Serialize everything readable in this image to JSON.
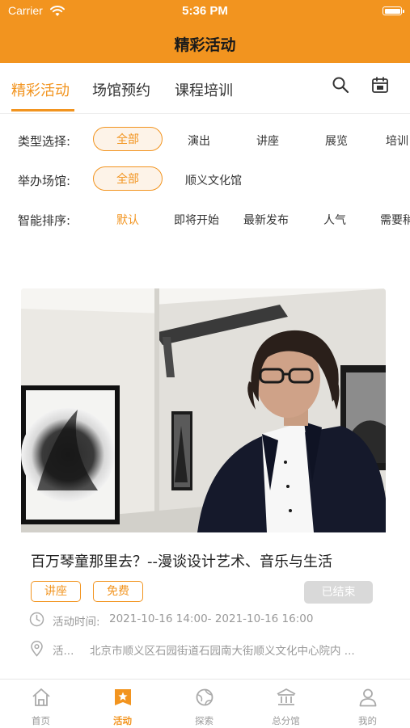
{
  "status_bar": {
    "carrier": "Carrier",
    "time": "5:36 PM"
  },
  "nav": {
    "title": "精彩活动"
  },
  "tabs": [
    {
      "label": "精彩活动"
    },
    {
      "label": "场馆预约"
    },
    {
      "label": "课程培训"
    }
  ],
  "icons": {
    "search": "search-icon",
    "calendar": "calendar-icon"
  },
  "filters": {
    "type": {
      "label": "类型选择:",
      "options": [
        "全部",
        "演出",
        "讲座",
        "展览",
        "培训"
      ]
    },
    "venue": {
      "label": "举办场馆:",
      "options": [
        "全部",
        "顺义文化馆"
      ]
    },
    "sort": {
      "label": "智能排序:",
      "options": [
        "默认",
        "即将开始",
        "最新发布",
        "人气",
        "需要稍"
      ]
    }
  },
  "event": {
    "title": "百万琴童那里去？--漫谈设计艺术、音乐与生活",
    "tags": [
      "讲座",
      "免费"
    ],
    "status": "已结束",
    "time_label": "活动时间:",
    "time_value": "2021-10-16 14:00- 2021-10-16 16:00",
    "place_label": "活...",
    "place_value": "北京市顺义区石园街道石园南大街顺义文化中心院内 ..."
  },
  "bottom_nav": [
    {
      "label": "首页",
      "icon": "home-icon"
    },
    {
      "label": "活动",
      "icon": "star-icon"
    },
    {
      "label": "探索",
      "icon": "explore-icon"
    },
    {
      "label": "总分馆",
      "icon": "library-icon"
    },
    {
      "label": "我的",
      "icon": "user-icon"
    }
  ],
  "colors": {
    "accent": "#f2941f",
    "text": "#333333",
    "muted": "#999999",
    "ended_badge": "#d9d9d9"
  }
}
